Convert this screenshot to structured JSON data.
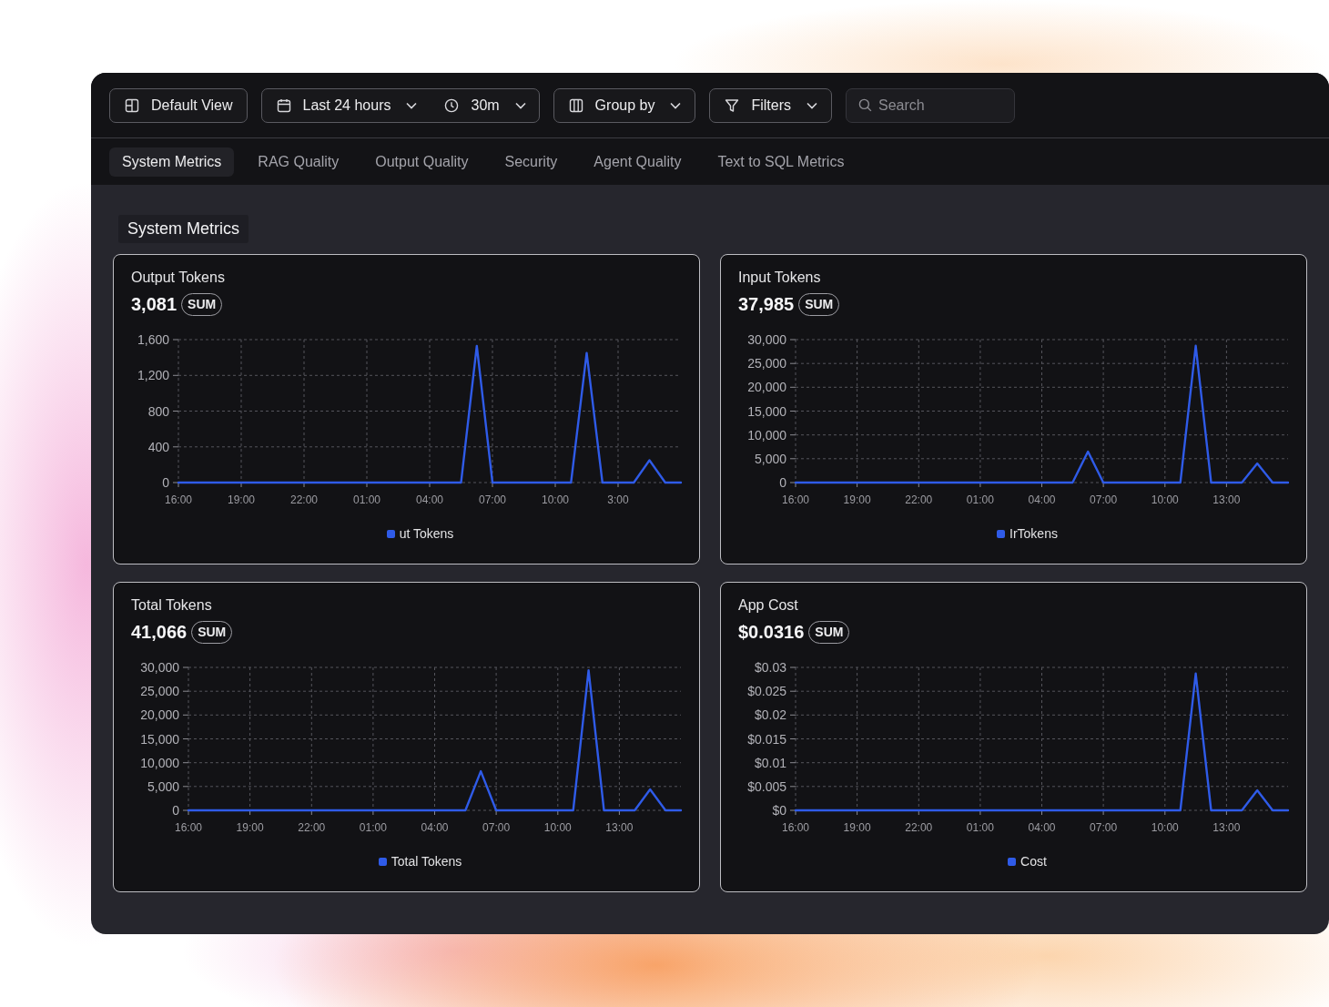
{
  "toolbar": {
    "view_button": {
      "label": "Default View"
    },
    "time_range": {
      "label": "Last 24 hours"
    },
    "interval": {
      "label": "30m"
    },
    "group_by": {
      "label": "Group by"
    },
    "filters": {
      "label": "Filters"
    },
    "search": {
      "placeholder": "Search"
    }
  },
  "tabs": [
    {
      "label": "System Metrics",
      "selected": true
    },
    {
      "label": "RAG Quality",
      "selected": false
    },
    {
      "label": "Output Quality",
      "selected": false
    },
    {
      "label": "Security",
      "selected": false
    },
    {
      "label": "Agent Quality",
      "selected": false
    },
    {
      "label": "Text to SQL Metrics",
      "selected": false
    }
  ],
  "section": {
    "title": "System Metrics"
  },
  "cards": [
    {
      "title": "Output Tokens",
      "value": "3,081",
      "aggregate": "SUM",
      "chart_data": {
        "type": "line",
        "grid": true,
        "categories": [
          "16:00",
          null,
          null,
          null,
          "19:00",
          null,
          null,
          null,
          "22:00",
          null,
          null,
          null,
          "01:00",
          null,
          null,
          null,
          "04:00",
          null,
          null,
          null,
          "07:00",
          null,
          null,
          null,
          "10:00",
          null,
          null,
          null,
          "3:00",
          null,
          null,
          null,
          null
        ],
        "series": [
          {
            "name": "ut Tokens",
            "color": "#2f5be8",
            "values": [
              0,
              0,
              0,
              0,
              0,
              0,
              0,
              0,
              0,
              0,
              0,
              0,
              0,
              0,
              0,
              0,
              0,
              0,
              0,
              1530,
              0,
              0,
              0,
              0,
              0,
              0,
              1450,
              0,
              0,
              0,
              250,
              0,
              0
            ]
          }
        ],
        "ylim": [
          0,
          1600
        ],
        "yticks": [
          0,
          400,
          800,
          {
            "value": 1200,
            "label": "1,200"
          },
          {
            "value": 1600,
            "label": "1,600"
          }
        ]
      }
    },
    {
      "title": "Input Tokens",
      "value": "37,985",
      "aggregate": "SUM",
      "chart_data": {
        "type": "line",
        "grid": true,
        "categories": [
          "16:00",
          null,
          null,
          null,
          "19:00",
          null,
          null,
          null,
          "22:00",
          null,
          null,
          null,
          "01:00",
          null,
          null,
          null,
          "04:00",
          null,
          null,
          null,
          "07:00",
          null,
          null,
          null,
          "10:00",
          null,
          null,
          null,
          "13:00",
          null,
          null,
          null,
          null
        ],
        "series": [
          {
            "name": "IrTokens",
            "color": "#2f5be8",
            "values": [
              0,
              0,
              0,
              0,
              0,
              0,
              0,
              0,
              0,
              0,
              0,
              0,
              0,
              0,
              0,
              0,
              0,
              0,
              0,
              6500,
              0,
              0,
              0,
              0,
              0,
              0,
              28700,
              0,
              0,
              0,
              4000,
              0,
              0
            ]
          }
        ],
        "ylim": [
          0,
          30000
        ],
        "yticks": [
          0,
          {
            "value": 5000,
            "label": "5,000"
          },
          {
            "value": 10000,
            "label": "10,000"
          },
          {
            "value": 15000,
            "label": "15,000"
          },
          {
            "value": 20000,
            "label": "20,000"
          },
          {
            "value": 25000,
            "label": "25,000"
          },
          {
            "value": 30000,
            "label": "30,000"
          }
        ]
      }
    },
    {
      "title": "Total Tokens",
      "value": "41,066",
      "aggregate": "SUM",
      "chart_data": {
        "type": "line",
        "grid": true,
        "categories": [
          "16:00",
          null,
          null,
          null,
          "19:00",
          null,
          null,
          null,
          "22:00",
          null,
          null,
          null,
          "01:00",
          null,
          null,
          null,
          "04:00",
          null,
          null,
          null,
          "07:00",
          null,
          null,
          null,
          "10:00",
          null,
          null,
          null,
          "13:00",
          null,
          null,
          null,
          null
        ],
        "series": [
          {
            "name": "Total Tokens",
            "color": "#2f5be8",
            "values": [
              0,
              0,
              0,
              0,
              0,
              0,
              0,
              0,
              0,
              0,
              0,
              0,
              0,
              0,
              0,
              0,
              0,
              0,
              0,
              8200,
              0,
              0,
              0,
              0,
              0,
              0,
              29400,
              0,
              0,
              0,
              4400,
              0,
              0
            ]
          }
        ],
        "ylim": [
          0,
          30000
        ],
        "yticks": [
          0,
          {
            "value": 5000,
            "label": "5,000"
          },
          {
            "value": 10000,
            "label": "10,000"
          },
          {
            "value": 15000,
            "label": "15,000"
          },
          {
            "value": 20000,
            "label": "20,000"
          },
          {
            "value": 25000,
            "label": "25,000"
          },
          {
            "value": 30000,
            "label": "30,000"
          }
        ]
      }
    },
    {
      "title": "App Cost",
      "value": "$0.0316",
      "aggregate": "SUM",
      "chart_data": {
        "type": "line",
        "grid": true,
        "categories": [
          "16:00",
          null,
          null,
          null,
          "19:00",
          null,
          null,
          null,
          "22:00",
          null,
          null,
          null,
          "01:00",
          null,
          null,
          null,
          "04:00",
          null,
          null,
          null,
          "07:00",
          null,
          null,
          null,
          "10:00",
          null,
          null,
          null,
          "13:00",
          null,
          null,
          null,
          null
        ],
        "series": [
          {
            "name": "Cost",
            "color": "#2f5be8",
            "values": [
              0,
              0,
              0,
              0,
              0,
              0,
              0,
              0,
              0,
              0,
              0,
              0,
              0,
              0,
              0,
              0,
              0,
              0,
              0,
              0,
              0,
              0,
              0,
              0,
              0,
              0,
              0.0287,
              0,
              0,
              0,
              0.0042,
              0,
              0
            ]
          }
        ],
        "ylim": [
          0,
          0.03
        ],
        "yticks": [
          {
            "value": 0,
            "label": "$0"
          },
          {
            "value": 0.005,
            "label": "$0.005"
          },
          {
            "value": 0.01,
            "label": "$0.01"
          },
          {
            "value": 0.015,
            "label": "$0.015"
          },
          {
            "value": 0.02,
            "label": "$0.02"
          },
          {
            "value": 0.025,
            "label": "$0.025"
          },
          {
            "value": 0.03,
            "label": "$0.03"
          }
        ]
      }
    }
  ]
}
